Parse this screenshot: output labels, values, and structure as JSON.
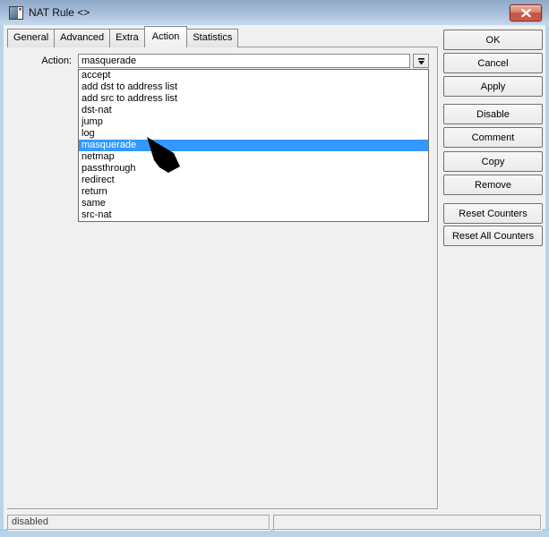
{
  "window": {
    "title": "NAT Rule <>",
    "status_left": "disabled",
    "status_right": ""
  },
  "tabs": [
    {
      "label": "General",
      "active": false
    },
    {
      "label": "Advanced",
      "active": false
    },
    {
      "label": "Extra",
      "active": false
    },
    {
      "label": "Action",
      "active": true
    },
    {
      "label": "Statistics",
      "active": false
    }
  ],
  "action_field": {
    "label": "Action:",
    "value": "masquerade"
  },
  "dropdown": {
    "selected": "masquerade",
    "items": [
      "accept",
      "add dst to address list",
      "add src to address list",
      "dst-nat",
      "jump",
      "log",
      "masquerade",
      "netmap",
      "passthrough",
      "redirect",
      "return",
      "same",
      "src-nat"
    ]
  },
  "buttons": [
    {
      "id": "ok",
      "label": "OK"
    },
    {
      "id": "cancel",
      "label": "Cancel"
    },
    {
      "id": "apply",
      "label": "Apply"
    },
    {
      "id": "disable",
      "label": "Disable"
    },
    {
      "id": "comment",
      "label": "Comment"
    },
    {
      "id": "copy",
      "label": "Copy"
    },
    {
      "id": "remove",
      "label": "Remove"
    },
    {
      "id": "reset-counters",
      "label": "Reset Counters"
    },
    {
      "id": "reset-all-counters",
      "label": "Reset All Counters"
    }
  ],
  "icons": {
    "window_icon": "winbox-window-icon",
    "close_icon": "close-x",
    "dropdown_icon": "down-arrow-with-bar"
  },
  "colors": {
    "selection": "#3399ff",
    "titlebar_top": "#8ea9c8",
    "titlebar_bottom": "#c6d9ec",
    "window_border": "#b9d4ea",
    "close_button_red": "#c45546",
    "dialog_bg": "#f0f0f0"
  }
}
